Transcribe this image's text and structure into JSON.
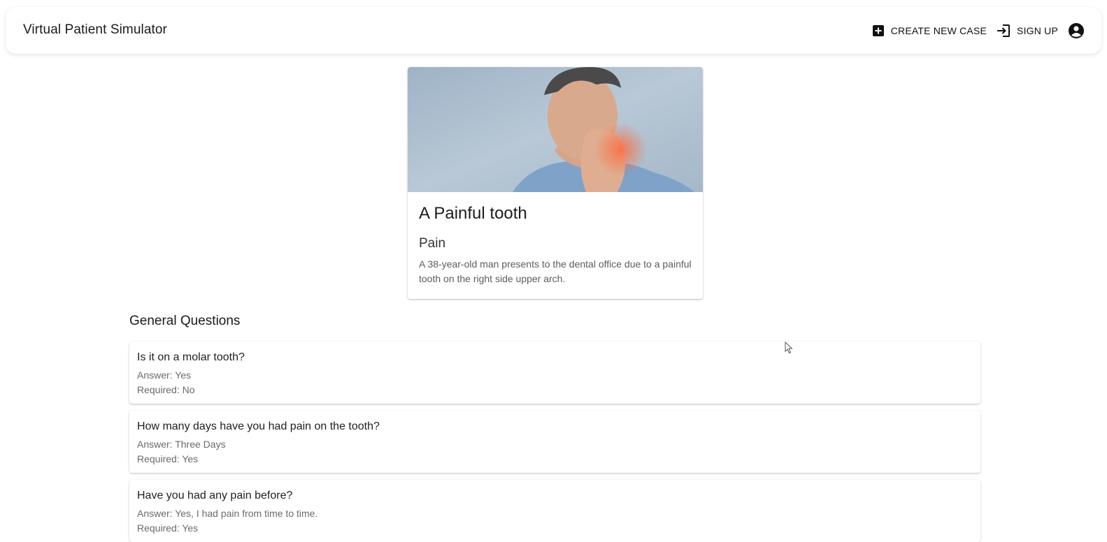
{
  "app": {
    "title": "Virtual Patient Simulator"
  },
  "nav": {
    "create_case_label": "CREATE NEW CASE",
    "create_case_icon": "add-box-icon",
    "sign_up_label": "SIGN UP",
    "sign_up_icon": "login-icon",
    "profile_icon": "account-circle-icon"
  },
  "case": {
    "title": "A Painful tooth",
    "subtitle": "Pain",
    "description": "A 38-year-old man presents to the dental office due to a painful tooth on the right side upper arch.",
    "image_alt": "man holding his jaw in pain"
  },
  "questions_section": {
    "heading": "General Questions",
    "items": [
      {
        "question": "Is it on a molar tooth?",
        "answer": "Answer: Yes",
        "required": "Required: No"
      },
      {
        "question": "How many days have you had pain on the tooth?",
        "answer": "Answer: Three Days",
        "required": "Required: Yes"
      },
      {
        "question": "Have you had any pain before?",
        "answer": "Answer: Yes, I had pain from time to time.",
        "required": "Required: Yes"
      }
    ]
  },
  "colors": {
    "background": "#ffffff",
    "text_primary": "#1f1f1f",
    "text_secondary": "#6a6a6a"
  }
}
